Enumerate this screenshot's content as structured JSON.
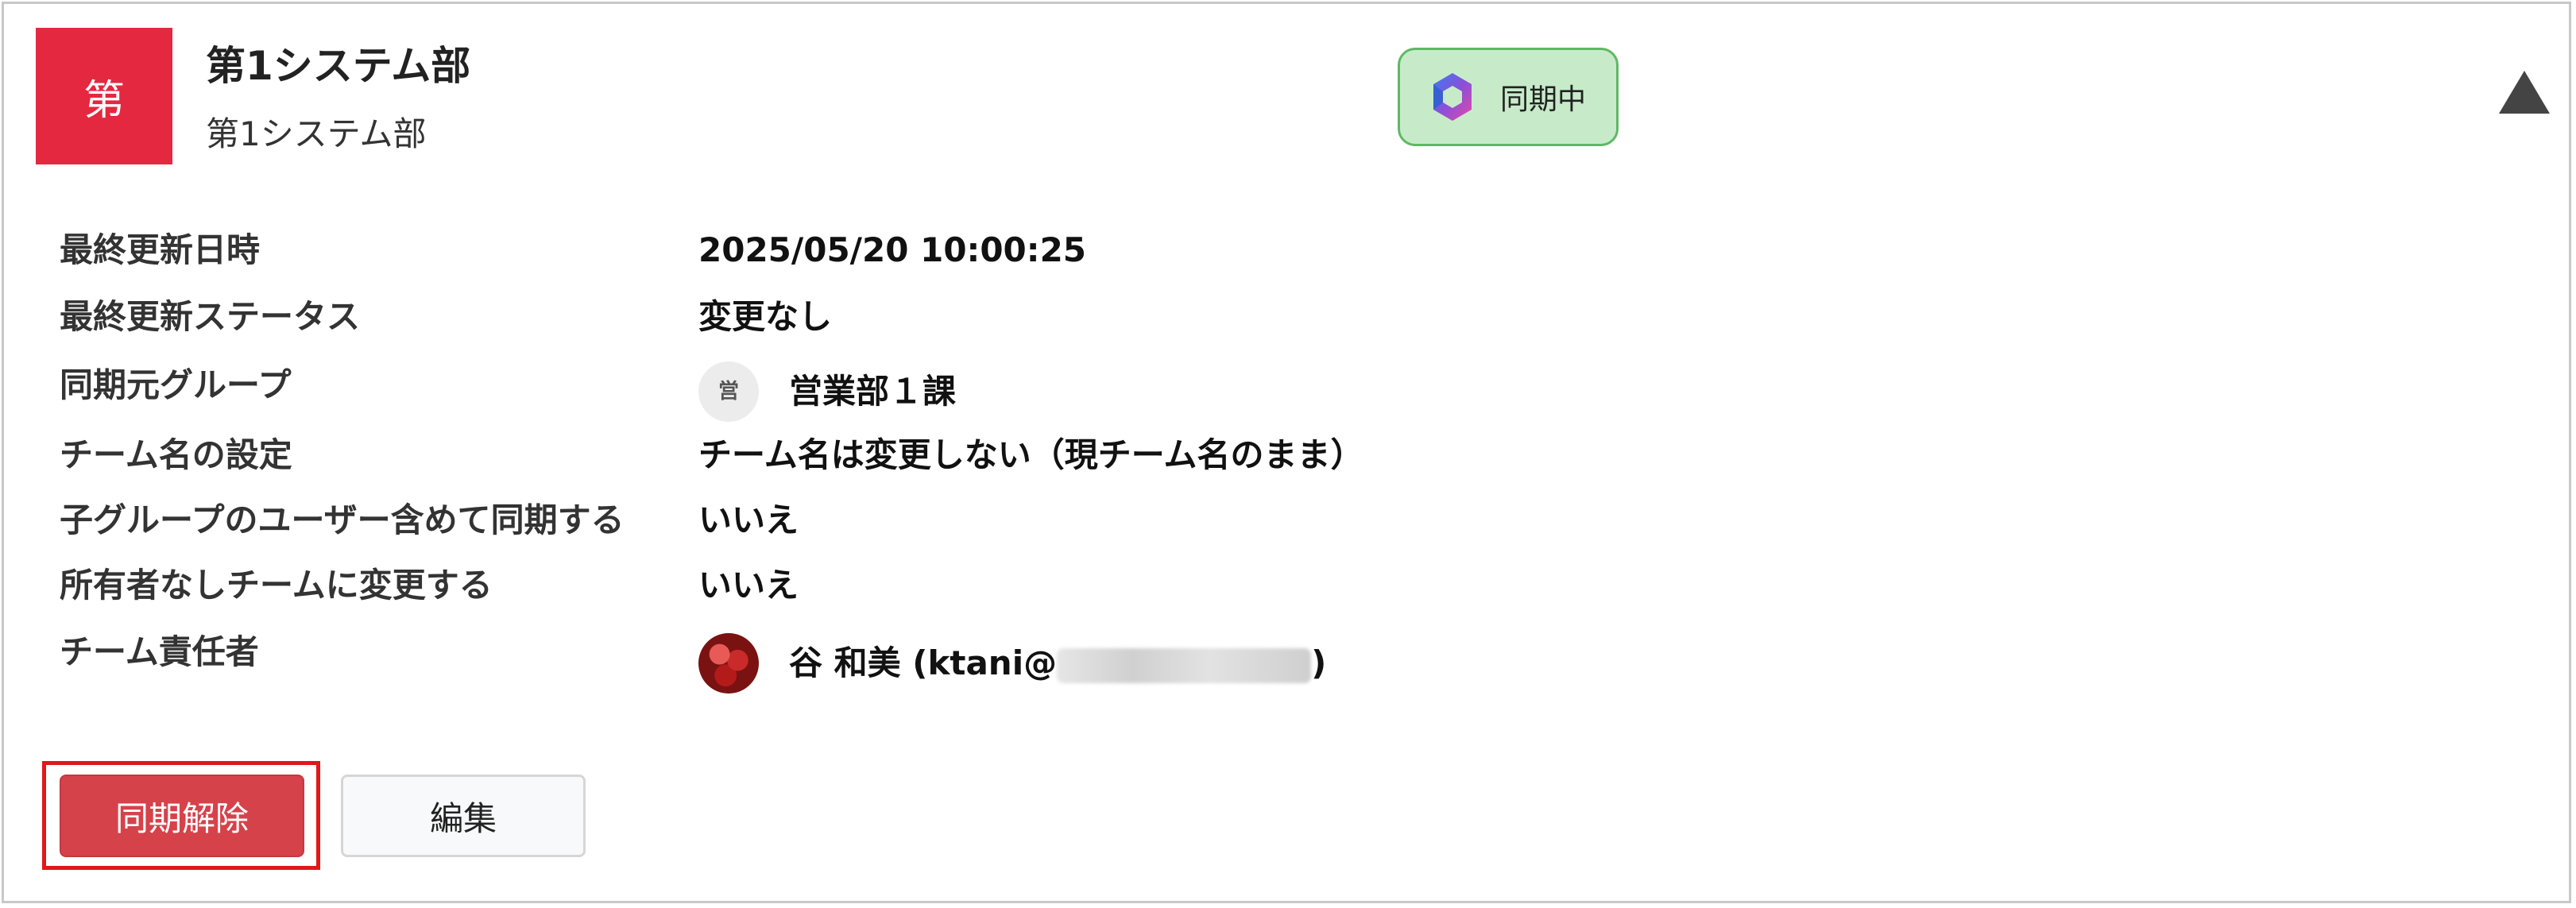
{
  "team": {
    "avatar_initial": "第",
    "name": "第1システム部",
    "subtitle": "第1システム部"
  },
  "sync_badge": {
    "label": "同期中",
    "icon": "teams-sync-icon"
  },
  "collapse_icon": "triangle-up-icon",
  "details": [
    {
      "label": "最終更新日時",
      "value": "2025/05/20 10:00:25"
    },
    {
      "label": "最終更新ステータス",
      "value": "変更なし"
    },
    {
      "label": "同期元グループ",
      "value": "営業部１課",
      "avatar_text": "営"
    },
    {
      "label": "チーム名の設定",
      "value": "チーム名は変更しない（現チーム名のまま）"
    },
    {
      "label": "子グループのユーザー含めて同期する",
      "value": "いいえ"
    },
    {
      "label": "所有者なしチームに変更する",
      "value": "いいえ"
    },
    {
      "label": "チーム責任者",
      "value": "谷 和美 (ktani@",
      "value_suffix": ")"
    }
  ],
  "buttons": {
    "unsync": "同期解除",
    "edit": "編集"
  },
  "colors": {
    "team_avatar": "#e3283f",
    "badge_bg": "#c7ebc9",
    "badge_border": "#5fb864",
    "unsync_button": "#d6424a",
    "highlight": "#e01818"
  }
}
